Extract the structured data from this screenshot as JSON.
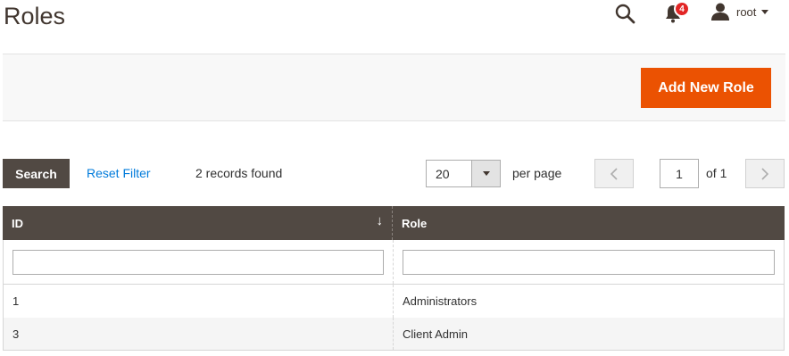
{
  "page": {
    "title": "Roles"
  },
  "header": {
    "notification_count": "4",
    "username": "root"
  },
  "actions": {
    "add_label": "Add New Role"
  },
  "toolbar": {
    "search_label": "Search",
    "reset_label": "Reset Filter",
    "records_text": "2 records found",
    "per_page_value": "20",
    "per_page_label": "per page",
    "current_page": "1",
    "page_total_text": "of 1"
  },
  "grid": {
    "columns": {
      "id": "ID",
      "role": "Role"
    },
    "rows": [
      {
        "id": "1",
        "role": "Administrators"
      },
      {
        "id": "3",
        "role": "Client Admin"
      }
    ]
  },
  "colors": {
    "accent": "#eb5202",
    "header_dark": "#514943",
    "link": "#007bdb",
    "badge": "#e22626"
  },
  "icons": {
    "search": "search-icon",
    "notifications": "bell-icon",
    "user": "user-icon",
    "sort": "sort-down-arrow-icon"
  }
}
